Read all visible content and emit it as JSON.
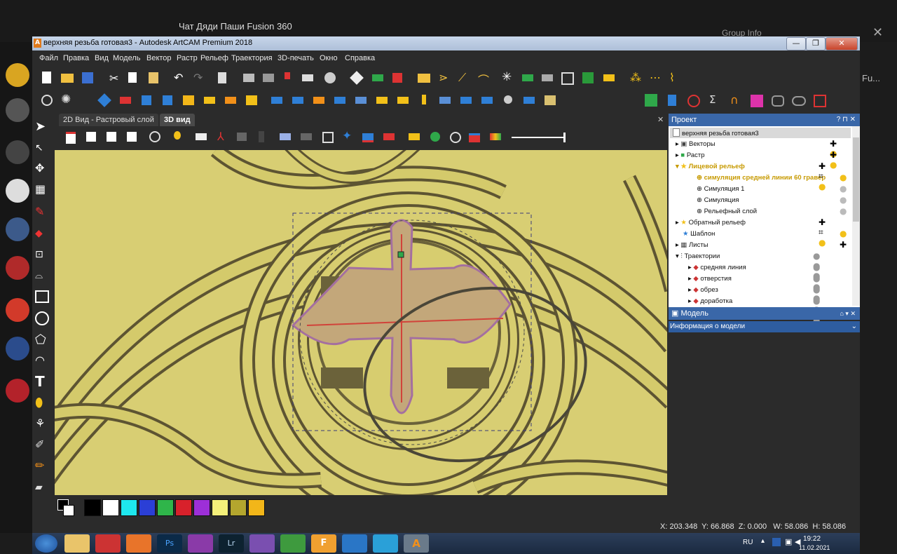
{
  "background_app": {
    "chat_title": "Чат Дяди Паши Fusion 360",
    "group_info_label": "Group Info",
    "right_snippet": "Fu..."
  },
  "window": {
    "title": "верхняя резьба готовая3 - Autodesk ArtCAM Premium 2018",
    "minimize": "—",
    "maximize": "❐",
    "close": "✕"
  },
  "menu": [
    "Файл",
    "Правка",
    "Вид",
    "Модель",
    "Вектор",
    "Растр",
    "Рельеф",
    "Траектория",
    "3D-печать",
    "Окно",
    "Справка"
  ],
  "view_tabs": {
    "tab_2d": "2D Вид - Растровый слой",
    "tab_3d": "3D вид",
    "close_x": "✕"
  },
  "project_panel": {
    "title": "Проект",
    "controls": "? ⊓ ✕",
    "root": "верхняя резьба готовая3",
    "items": [
      {
        "label": "Векторы"
      },
      {
        "label": "Растр"
      },
      {
        "label": "Лицевой рельеф"
      },
      {
        "label": "симуляция средней линии 60 гравер"
      },
      {
        "label": "Симуляция  1"
      },
      {
        "label": "Симуляция"
      },
      {
        "label": "Рельефный слой"
      },
      {
        "label": "Обратный рельеф"
      },
      {
        "label": "Шаблон"
      },
      {
        "label": "Листы"
      },
      {
        "label": "Траектории"
      },
      {
        "label": "средняя линия"
      },
      {
        "label": "отверстия"
      },
      {
        "label": "обрез"
      },
      {
        "label": "доработка"
      }
    ]
  },
  "model_panel": {
    "title": "Модель"
  },
  "info_panel": {
    "title": "Информация о модели"
  },
  "status": {
    "x": "X: 203.348",
    "y": "Y: 66.868",
    "z": "Z: 0.000",
    "w": "W: 58.086",
    "h": "H: 58.086"
  },
  "palette": [
    "#000000",
    "#ffffff",
    "#1ee7ee",
    "#2b3fd6",
    "#2fb54a",
    "#d8212b",
    "#9d2fd8",
    "#f4f07a",
    "#b4a62e",
    "#f2b619"
  ],
  "taskbar": {
    "lang": "RU",
    "time": "19:22",
    "date": "11.02.2021",
    "apps": [
      "start",
      "explorer",
      "screenshot",
      "firefox",
      "photoshop",
      "floppy",
      "lightroom",
      "viber",
      "utorrent",
      "fusion",
      "ai",
      "telegram",
      "artcam"
    ]
  }
}
